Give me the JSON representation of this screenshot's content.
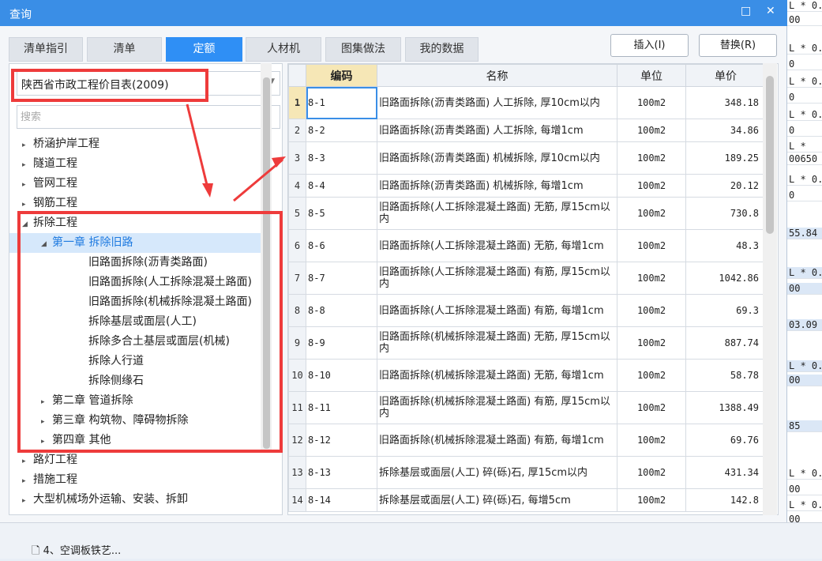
{
  "window": {
    "title": "查询"
  },
  "tabs": [
    "清单指引",
    "清单",
    "定额",
    "人材机",
    "图集做法",
    "我的数据"
  ],
  "buttons": {
    "insert": "插入(I)",
    "replace": "替换(R)"
  },
  "combo": {
    "value": "陕西省市政工程价目表(2009)"
  },
  "search": {
    "placeholder": "搜索"
  },
  "tree": [
    {
      "label": "桥涵护岸工程"
    },
    {
      "label": "隧道工程"
    },
    {
      "label": "管网工程"
    },
    {
      "label": "钢筋工程"
    },
    {
      "label": "拆除工程"
    },
    {
      "label": "第一章 拆除旧路"
    },
    {
      "label": "旧路面拆除(沥青类路面)"
    },
    {
      "label": "旧路面拆除(人工拆除混凝土路面)"
    },
    {
      "label": "旧路面拆除(机械拆除混凝土路面)"
    },
    {
      "label": "拆除基层或面层(人工)"
    },
    {
      "label": "拆除多合土基层或面层(机械)"
    },
    {
      "label": "拆除人行道"
    },
    {
      "label": "拆除侧缘石"
    },
    {
      "label": "第二章 管道拆除"
    },
    {
      "label": "第三章 构筑物、障碍物拆除"
    },
    {
      "label": "第四章 其他"
    },
    {
      "label": "路灯工程"
    },
    {
      "label": "措施工程"
    },
    {
      "label": "大型机械场外运输、安装、拆卸"
    }
  ],
  "grid": {
    "headers": [
      "编码",
      "名称",
      "单位",
      "单价"
    ],
    "rows": [
      {
        "no": "1",
        "code": "8-1",
        "name": "旧路面拆除(沥青类路面) 人工拆除, 厚10cm以内",
        "unit": "100m2",
        "price": "348.18"
      },
      {
        "no": "2",
        "code": "8-2",
        "name": "旧路面拆除(沥青类路面) 人工拆除, 每增1cm",
        "unit": "100m2",
        "price": "34.86"
      },
      {
        "no": "3",
        "code": "8-3",
        "name": "旧路面拆除(沥青类路面) 机械拆除, 厚10cm以内",
        "unit": "100m2",
        "price": "189.25"
      },
      {
        "no": "4",
        "code": "8-4",
        "name": "旧路面拆除(沥青类路面) 机械拆除, 每增1cm",
        "unit": "100m2",
        "price": "20.12"
      },
      {
        "no": "5",
        "code": "8-5",
        "name": "旧路面拆除(人工拆除混凝土路面) 无筋, 厚15cm以内",
        "unit": "100m2",
        "price": "730.8"
      },
      {
        "no": "6",
        "code": "8-6",
        "name": "旧路面拆除(人工拆除混凝土路面) 无筋, 每增1cm",
        "unit": "100m2",
        "price": "48.3"
      },
      {
        "no": "7",
        "code": "8-7",
        "name": "旧路面拆除(人工拆除混凝土路面) 有筋, 厚15cm以内",
        "unit": "100m2",
        "price": "1042.86"
      },
      {
        "no": "8",
        "code": "8-8",
        "name": "旧路面拆除(人工拆除混凝土路面) 有筋, 每增1cm",
        "unit": "100m2",
        "price": "69.3"
      },
      {
        "no": "9",
        "code": "8-9",
        "name": "旧路面拆除(机械拆除混凝土路面) 无筋, 厚15cm以内",
        "unit": "100m2",
        "price": "887.74"
      },
      {
        "no": "10",
        "code": "8-10",
        "name": "旧路面拆除(机械拆除混凝土路面) 无筋, 每增1cm",
        "unit": "100m2",
        "price": "58.78"
      },
      {
        "no": "11",
        "code": "8-11",
        "name": "旧路面拆除(机械拆除混凝土路面) 有筋, 厚15cm以内",
        "unit": "100m2",
        "price": "1388.49"
      },
      {
        "no": "12",
        "code": "8-12",
        "name": "旧路面拆除(机械拆除混凝土路面) 有筋, 每增1cm",
        "unit": "100m2",
        "price": "69.76"
      },
      {
        "no": "13",
        "code": "8-13",
        "name": "拆除基层或面层(人工) 碎(砾)石, 厚15cm以内",
        "unit": "100m2",
        "price": "431.34"
      },
      {
        "no": "14",
        "code": "8-14",
        "name": "拆除基层或面层(人工) 碎(砾)石, 每增5cm",
        "unit": "100m2",
        "price": "142.8"
      }
    ]
  },
  "behind": [
    "L * 0.",
    "00",
    "L * 0.",
    "0",
    "L * 0.",
    "0",
    "L * 0.",
    "0",
    "L *",
    "00650",
    "L * 0.",
    "0",
    "55.84",
    "L * 0.",
    "00",
    "03.09",
    "L * 0.",
    "00",
    "85",
    "L * 0.",
    "00",
    "L * 0.",
    "00"
  ],
  "bottom": {
    "item": "4、空调板铁艺..."
  }
}
